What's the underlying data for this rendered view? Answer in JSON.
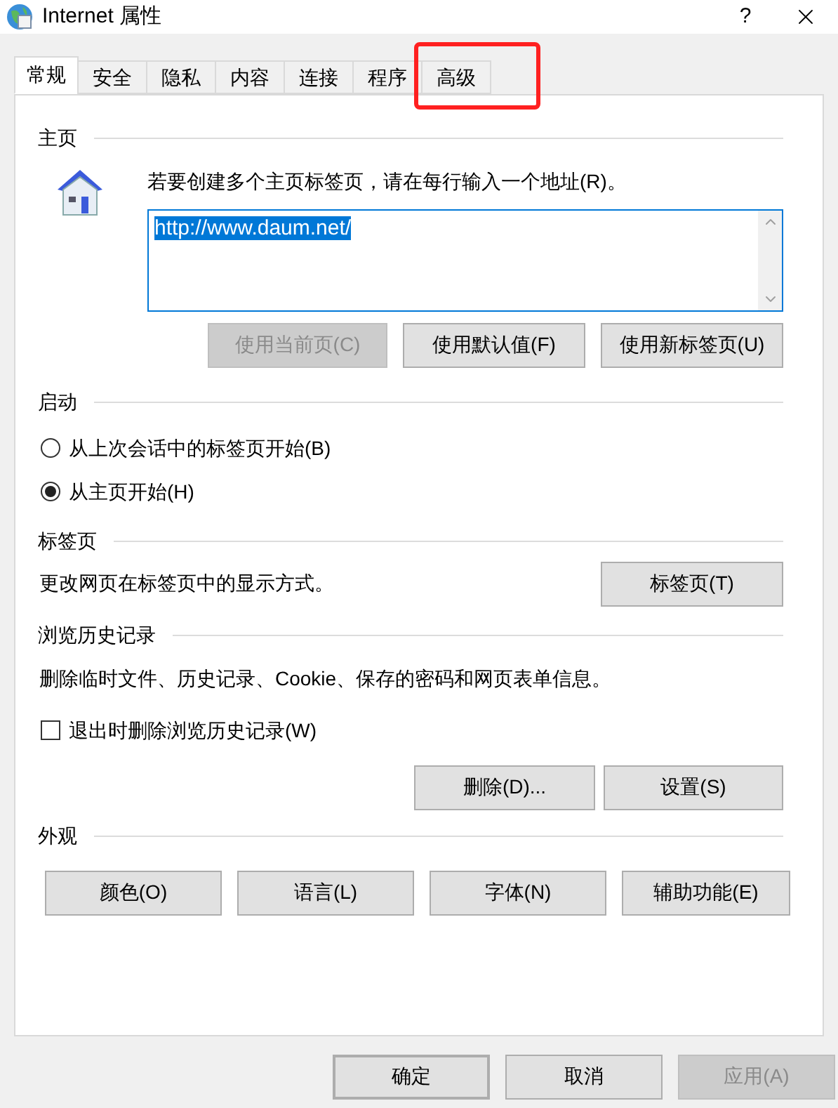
{
  "window": {
    "title": "Internet 属性",
    "help": "?"
  },
  "tabs": [
    {
      "label": "常规",
      "selected": true,
      "highlighted": false
    },
    {
      "label": "安全",
      "selected": false,
      "highlighted": false
    },
    {
      "label": "隐私",
      "selected": false,
      "highlighted": false
    },
    {
      "label": "内容",
      "selected": false,
      "highlighted": false
    },
    {
      "label": "连接",
      "selected": false,
      "highlighted": false
    },
    {
      "label": "程序",
      "selected": false,
      "highlighted": false
    },
    {
      "label": "高级",
      "selected": false,
      "highlighted": true
    }
  ],
  "home": {
    "heading": "主页",
    "instruction": "若要创建多个主页标签页，请在每行输入一个地址(R)。",
    "address": "http://www.daum.net/",
    "address_selected": true,
    "buttons": [
      {
        "label": "使用当前页(C)",
        "disabled": true
      },
      {
        "label": "使用默认值(F)",
        "disabled": false
      },
      {
        "label": "使用新标签页(U)",
        "disabled": false
      }
    ]
  },
  "startup": {
    "heading": "启动",
    "options": [
      {
        "label": "从上次会话中的标签页开始(B)",
        "selected": false
      },
      {
        "label": "从主页开始(H)",
        "selected": true
      }
    ]
  },
  "tabs_section": {
    "heading": "标签页",
    "description": "更改网页在标签页中的显示方式。",
    "button": {
      "label": "标签页(T)",
      "disabled": false
    }
  },
  "history": {
    "heading": "浏览历史记录",
    "description": "删除临时文件、历史记录、Cookie、保存的密码和网页表单信息。",
    "checkbox": {
      "label": "退出时删除浏览历史记录(W)",
      "checked": false
    },
    "buttons": [
      {
        "label": "删除(D)...",
        "disabled": false
      },
      {
        "label": "设置(S)",
        "disabled": false
      }
    ]
  },
  "appearance": {
    "heading": "外观",
    "buttons": [
      {
        "label": "颜色(O)",
        "disabled": false
      },
      {
        "label": "语言(L)",
        "disabled": false
      },
      {
        "label": "字体(N)",
        "disabled": false
      },
      {
        "label": "辅助功能(E)",
        "disabled": false
      }
    ]
  },
  "footer": [
    {
      "label": "确定",
      "disabled": false,
      "default": true
    },
    {
      "label": "取消",
      "disabled": false,
      "default": false
    },
    {
      "label": "应用(A)",
      "disabled": true,
      "default": false
    }
  ]
}
